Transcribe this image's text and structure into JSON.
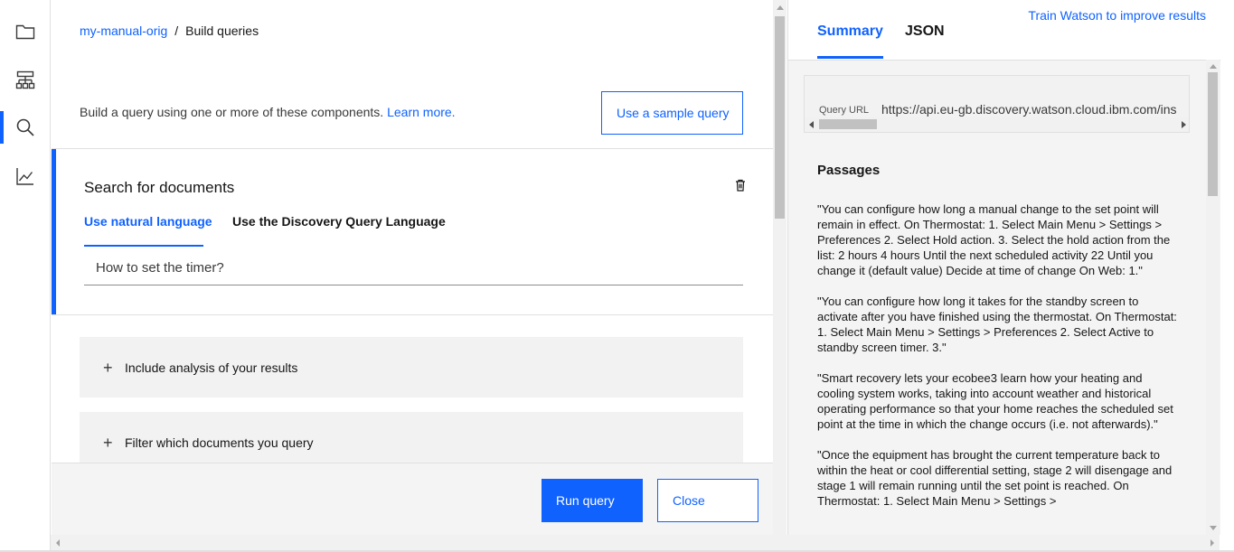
{
  "nav": {
    "items": [
      {
        "icon": "folder-icon",
        "active": false
      },
      {
        "icon": "hierarchy-icon",
        "active": false
      },
      {
        "icon": "search-icon",
        "active": true
      },
      {
        "icon": "analytics-icon",
        "active": false
      }
    ]
  },
  "breadcrumb": {
    "collection": "my-manual-orig",
    "separator": "/",
    "current": "Build queries"
  },
  "intro": {
    "text": "Build a query using one or more of these components.",
    "link": "Learn more."
  },
  "sample_button": "Use a sample query",
  "search_section": {
    "title": "Search for documents",
    "tabs": [
      {
        "label": "Use natural language",
        "selected": true
      },
      {
        "label": "Use the Discovery Query Language",
        "selected": false
      }
    ],
    "query_value": "How to set the timer?"
  },
  "accordions": [
    {
      "label": "Include analysis of your results"
    },
    {
      "label": "Filter which documents you query"
    }
  ],
  "footer": {
    "run_label": "Run query",
    "close_label": "Close"
  },
  "right_panel": {
    "train_link": "Train Watson to improve results",
    "tabs": [
      {
        "label": "Summary",
        "selected": true
      },
      {
        "label": "JSON",
        "selected": false
      }
    ],
    "query_url_label": "Query URL",
    "query_url_value": "https://api.eu-gb.discovery.watson.cloud.ibm.com/ins",
    "passages_title": "Passages",
    "passages": [
      "\"You can configure how long a manual change to the set point will remain in effect. On Thermostat: 1. Select Main Menu > Settings > Preferences 2. Select Hold action. 3. Select the hold action from the list: 2 hours 4 hours Until the next scheduled activity 22 Until you change it (default value) Decide at time of change On Web: 1.\"",
      "\"You can configure how long it takes for the standby screen to activate after you have finished using the thermostat. On Thermostat: 1. Select Main Menu > Settings > Preferences 2. Select Active to standby screen timer. 3.\"",
      "\"Smart recovery lets your ecobee3 learn how your heating and cooling system works, taking into account weather and historical operating performance so that your home reaches the scheduled set point at the time in which the change occurs (i.e. not afterwards).\"",
      "\"Once the equipment has brought the current temperature back to within the heat or cool differential setting, stage 2 will disengage and stage 1 will remain running until the set point is reached. On Thermostat: 1. Select Main Menu > Settings >"
    ]
  },
  "colors": {
    "accent": "#0f62fe",
    "panel_bg": "#f4f4f4",
    "accordion_bg": "#f2f2f2"
  }
}
